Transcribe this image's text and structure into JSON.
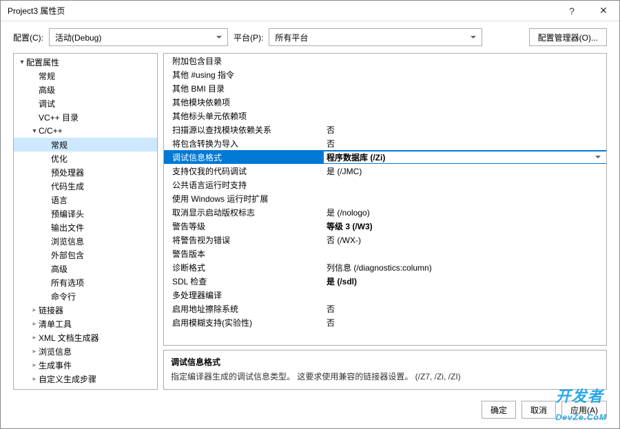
{
  "titlebar": {
    "title": "Project3 属性页",
    "help": "?",
    "close": "✕"
  },
  "toolbar": {
    "config_label": "配置(C):",
    "config_value": "活动(Debug)",
    "platform_label": "平台(P):",
    "platform_value": "所有平台",
    "config_manager": "配置管理器(O)..."
  },
  "tree": [
    {
      "label": "配置属性",
      "level": 0,
      "caret": "open"
    },
    {
      "label": "常规",
      "level": 1,
      "caret": "none"
    },
    {
      "label": "高级",
      "level": 1,
      "caret": "none"
    },
    {
      "label": "调试",
      "level": 1,
      "caret": "none"
    },
    {
      "label": "VC++ 目录",
      "level": 1,
      "caret": "none"
    },
    {
      "label": "C/C++",
      "level": 1,
      "caret": "open"
    },
    {
      "label": "常规",
      "level": 2,
      "caret": "none",
      "selected": true
    },
    {
      "label": "优化",
      "level": 2,
      "caret": "none"
    },
    {
      "label": "预处理器",
      "level": 2,
      "caret": "none"
    },
    {
      "label": "代码生成",
      "level": 2,
      "caret": "none"
    },
    {
      "label": "语言",
      "level": 2,
      "caret": "none"
    },
    {
      "label": "预编译头",
      "level": 2,
      "caret": "none"
    },
    {
      "label": "输出文件",
      "level": 2,
      "caret": "none"
    },
    {
      "label": "浏览信息",
      "level": 2,
      "caret": "none"
    },
    {
      "label": "外部包含",
      "level": 2,
      "caret": "none"
    },
    {
      "label": "高级",
      "level": 2,
      "caret": "none"
    },
    {
      "label": "所有选项",
      "level": 2,
      "caret": "none"
    },
    {
      "label": "命令行",
      "level": 2,
      "caret": "none"
    },
    {
      "label": "链接器",
      "level": 1,
      "caret": "closed"
    },
    {
      "label": "清单工具",
      "level": 1,
      "caret": "closed"
    },
    {
      "label": "XML 文档生成器",
      "level": 1,
      "caret": "closed"
    },
    {
      "label": "浏览信息",
      "level": 1,
      "caret": "closed"
    },
    {
      "label": "生成事件",
      "level": 1,
      "caret": "closed"
    },
    {
      "label": "自定义生成步骤",
      "level": 1,
      "caret": "closed"
    }
  ],
  "grid": [
    {
      "label": "附加包含目录",
      "value": ""
    },
    {
      "label": "其他 #using 指令",
      "value": ""
    },
    {
      "label": "其他 BMI 目录",
      "value": ""
    },
    {
      "label": "其他模块依赖项",
      "value": ""
    },
    {
      "label": "其他标头单元依赖项",
      "value": ""
    },
    {
      "label": "扫描源以查找模块依赖关系",
      "value": "否"
    },
    {
      "label": "将包含转换为导入",
      "value": "否"
    },
    {
      "label": "调试信息格式",
      "value": "程序数据库 (/Zi)",
      "selected": true,
      "bold": true
    },
    {
      "label": "支持仅我的代码调试",
      "value": "是 (/JMC)"
    },
    {
      "label": "公共语言运行时支持",
      "value": ""
    },
    {
      "label": "使用 Windows 运行时扩展",
      "value": ""
    },
    {
      "label": "取消显示启动版权标志",
      "value": "是 (/nologo)"
    },
    {
      "label": "警告等级",
      "value": "等级 3 (/W3)",
      "bold": true
    },
    {
      "label": "将警告视为错误",
      "value": "否 (/WX-)"
    },
    {
      "label": "警告版本",
      "value": ""
    },
    {
      "label": "诊断格式",
      "value": "列信息 (/diagnostics:column)"
    },
    {
      "label": "SDL 检查",
      "value": "是 (/sdl)",
      "bold": true
    },
    {
      "label": "多处理器编译",
      "value": ""
    },
    {
      "label": "启用地址擦除系统",
      "value": "否"
    },
    {
      "label": "启用模糊支持(实验性)",
      "value": "否"
    }
  ],
  "desc": {
    "title": "调试信息格式",
    "text": "指定编译器生成的调试信息类型。 这要求使用兼容的链接器设置。   (/Z7, /Zi, /ZI)"
  },
  "footer": {
    "ok": "确定",
    "cancel": "取消",
    "apply": "应用(A)"
  },
  "watermark": "DevZe.CoM"
}
